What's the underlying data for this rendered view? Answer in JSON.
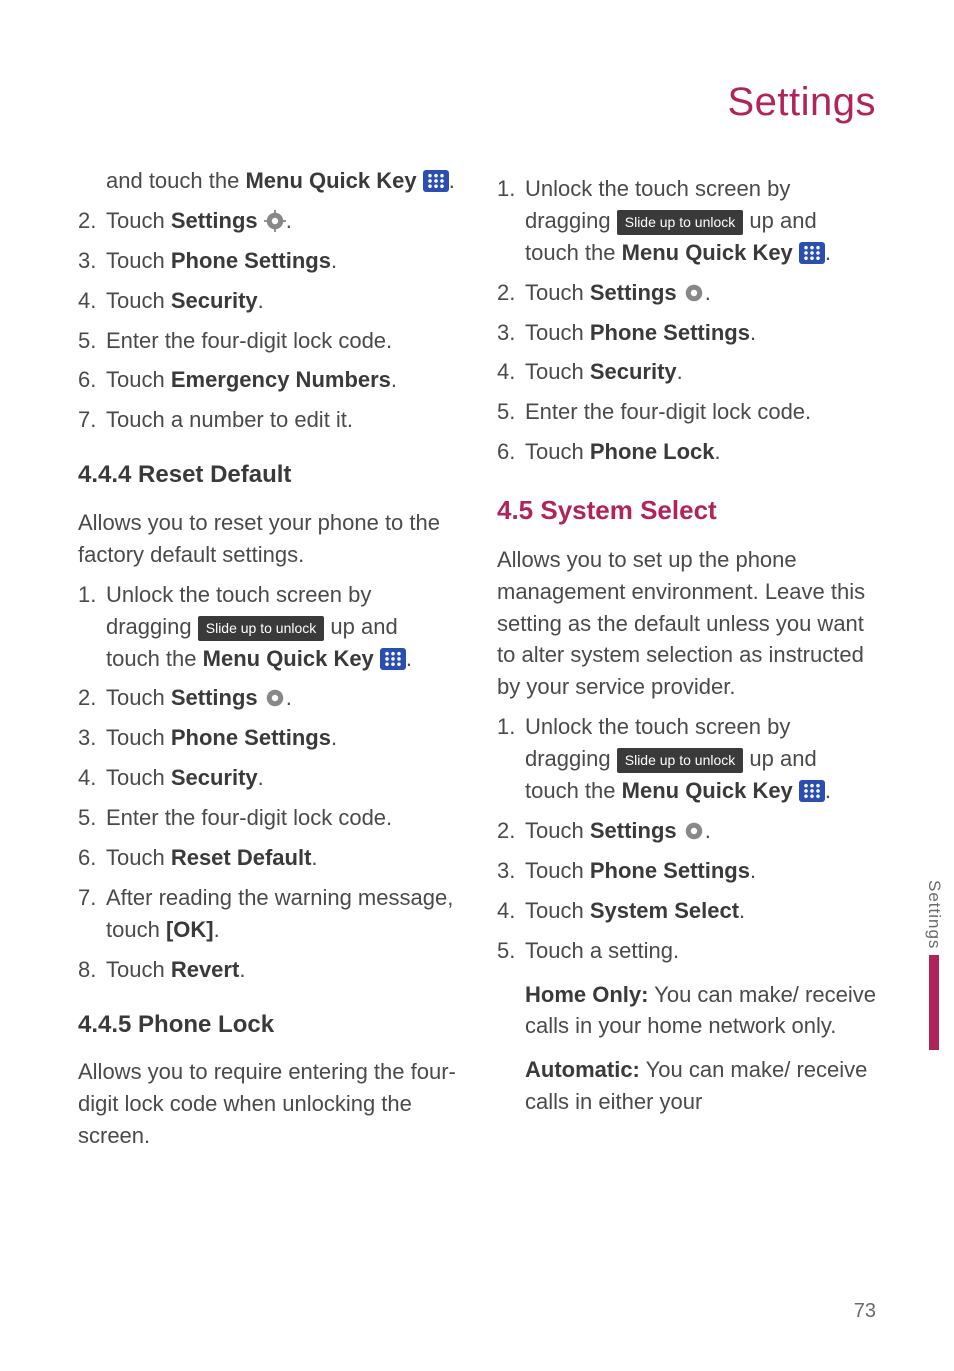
{
  "header": {
    "title": "Settings"
  },
  "side": {
    "label": "Settings"
  },
  "pagenum": "73",
  "icons": {
    "slide": "Slide up to unlock"
  },
  "left": {
    "cont1a": "and touch the ",
    "cont1b": "Menu Quick Key ",
    "s2a": "Touch ",
    "s2b": "Settings ",
    "s3a": "Touch ",
    "s3b": "Phone Settings",
    "s4a": "Touch ",
    "s4b": "Security",
    "s5": "Enter the four-digit lock code.",
    "s6a": "Touch ",
    "s6b": "Emergency Numbers",
    "s7": "Touch a number to edit it.",
    "h444": "4.4.4 Reset Default",
    "p444": "Allows you to reset your phone to the factory default settings.",
    "r1a": "Unlock the touch screen by dragging ",
    "r1b": " up and touch the ",
    "r1c": "Menu Quick Key ",
    "r2a": "Touch ",
    "r2b": "Settings ",
    "r3a": "Touch ",
    "r3b": "Phone Settings",
    "r4a": "Touch ",
    "r4b": "Security",
    "r5": "Enter the four-digit lock code.",
    "r6a": "Touch ",
    "r6b": "Reset Default",
    "r7a": "After reading the warning message, touch ",
    "r7b": "[OK]",
    "r8a": "Touch ",
    "r8b": "Revert",
    "h445": "4.4.5 Phone Lock",
    "p445": "Allows you to require entering the four-digit lock code when unlocking the screen."
  },
  "right": {
    "p1a": "Unlock the touch screen by dragging ",
    "p1b": " up and touch the ",
    "p1c": "Menu Quick Key ",
    "p2a": "Touch ",
    "p2b": "Settings ",
    "p3a": "Touch ",
    "p3b": "Phone Settings",
    "p4a": "Touch ",
    "p4b": "Security",
    "p5": "Enter the four-digit lock code.",
    "p6a": "Touch ",
    "p6b": "Phone Lock",
    "h45": "4.5 System Select",
    "p45": "Allows you to set up the phone management environment. Leave this setting as the default unless you want to alter system selection as instructed by your service provider.",
    "q1a": "Unlock the touch screen by dragging ",
    "q1b": " up and touch the ",
    "q1c": "Menu Quick Key ",
    "q2a": "Touch ",
    "q2b": "Settings ",
    "q3a": "Touch ",
    "q3b": "Phone Settings",
    "q4a": "Touch ",
    "q4b": "System Select",
    "q5": "Touch a setting.",
    "opt1a": "Home Only:",
    "opt1b": " You can make/ receive calls in your home network only.",
    "opt2a": "Automatic:",
    "opt2b": " You can make/ receive calls in either your"
  }
}
